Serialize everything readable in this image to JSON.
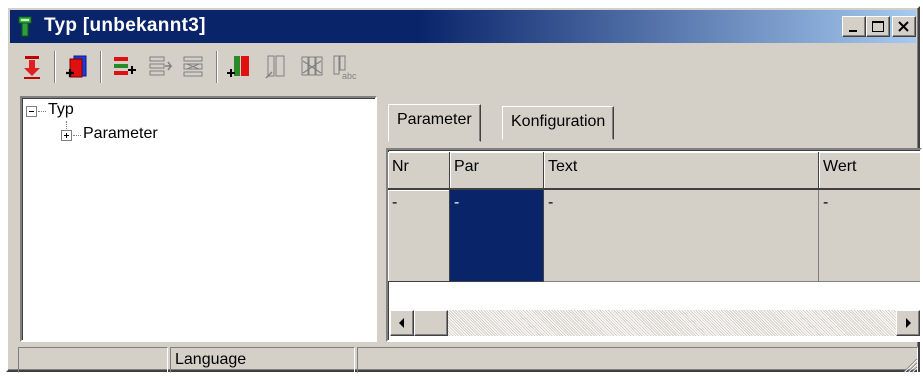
{
  "window": {
    "title": "Typ  [unbekannt3]",
    "accent": "#0a246a",
    "icon": "green-device-icon",
    "controls": [
      {
        "name": "minimize-button",
        "icon": "minimize-icon"
      },
      {
        "name": "maximize-button",
        "icon": "maximize-icon"
      },
      {
        "name": "close-button",
        "icon": "close-icon"
      }
    ]
  },
  "toolbar": {
    "buttons": [
      {
        "name": "download-button",
        "icon": "red-download-arrow-icon"
      },
      {
        "name": "add-parameter-block-button",
        "icon": "add-parameter-block-icon"
      },
      {
        "name": "add-row-button",
        "icon": "add-row-icon"
      },
      {
        "name": "insert-row-button",
        "icon": "insert-row-icon"
      },
      {
        "name": "delete-row-button",
        "icon": "delete-row-icon"
      },
      {
        "name": "add-column-button",
        "icon": "add-column-icon"
      },
      {
        "name": "insert-column-button",
        "icon": "insert-column-icon"
      },
      {
        "name": "delete-column-button",
        "icon": "delete-column-icon"
      },
      {
        "name": "text-column-button",
        "icon": "text-column-abc-icon"
      }
    ]
  },
  "tree": {
    "root": {
      "label": "Typ",
      "expanded": true
    },
    "children": [
      {
        "label": "Parameter",
        "expanded": false
      }
    ]
  },
  "tabs": [
    {
      "label": "Parameter",
      "active": true
    },
    {
      "label": "Konfiguration",
      "active": false
    }
  ],
  "grid": {
    "columns": [
      "Nr",
      "Par",
      "Text",
      "Wert"
    ],
    "rows": [
      [
        "-",
        "-",
        "-",
        "-"
      ]
    ],
    "selected_column": "Par"
  },
  "statusbar": {
    "panels": [
      "",
      "Language",
      ""
    ]
  }
}
